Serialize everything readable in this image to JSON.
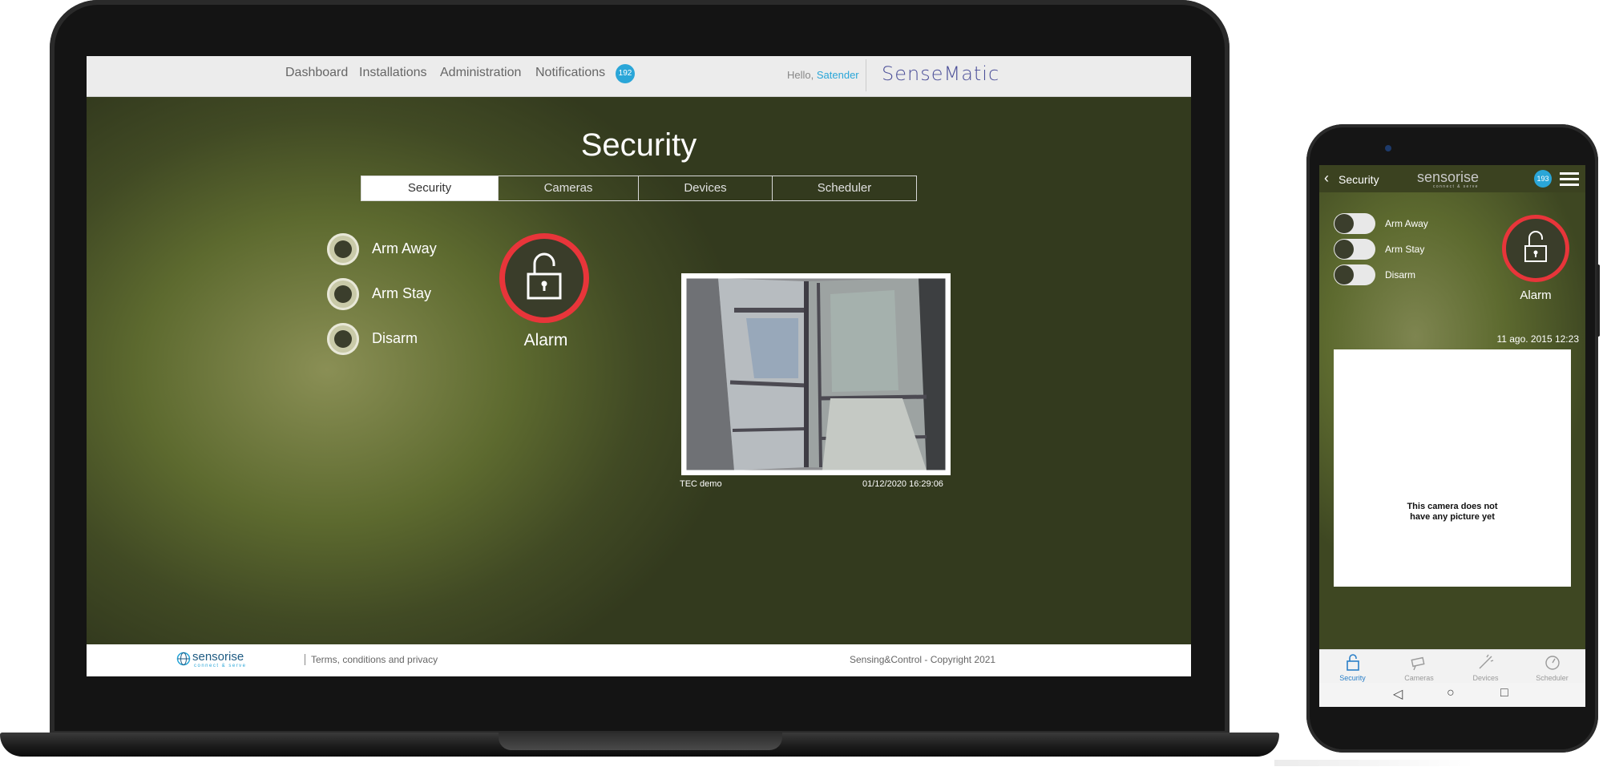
{
  "laptop": {
    "nav": {
      "links": [
        "Dashboard",
        "Installations",
        "Administration",
        "Notifications"
      ],
      "notifications_count": "192",
      "hello_text": "Hello,",
      "user_name": "Satender",
      "brand": "SenseMatic"
    },
    "page_title": "Security",
    "tabs": [
      {
        "label": "Security",
        "active": true
      },
      {
        "label": "Cameras",
        "active": false
      },
      {
        "label": "Devices",
        "active": false
      },
      {
        "label": "Scheduler",
        "active": false
      }
    ],
    "modes": [
      "Arm Away",
      "Arm Stay",
      "Disarm"
    ],
    "alarm_label": "Alarm",
    "camera": {
      "name": "TEC demo",
      "timestamp": "01/12/2020 16:29:06"
    },
    "footer": {
      "logo_name": "sensorise",
      "logo_tagline": "connect & serve",
      "terms": "Terms, conditions and privacy",
      "copyright": "Sensing&Control - Copyright 2021"
    }
  },
  "phone": {
    "header": {
      "title": "Security",
      "brand": "sensorise",
      "brand_tagline": "connect & serve",
      "notifications_count": "193"
    },
    "modes": [
      "Arm Away",
      "Arm Stay",
      "Disarm"
    ],
    "alarm_label": "Alarm",
    "camera_date": "11 ago. 2015 12:23",
    "camera_message_line1": "This camera does not",
    "camera_message_line2": "have any picture yet",
    "tabbar": [
      {
        "label": "Security",
        "icon": "lock-icon",
        "active": true
      },
      {
        "label": "Cameras",
        "icon": "camera-icon",
        "active": false
      },
      {
        "label": "Devices",
        "icon": "devices-icon",
        "active": false
      },
      {
        "label": "Scheduler",
        "icon": "clock-icon",
        "active": false
      }
    ]
  },
  "colors": {
    "accent_blue": "#2aa6d8",
    "alarm_red": "#e8353a",
    "brand_purple": "#4a4e98",
    "background_olive": "#5d6a2f"
  }
}
